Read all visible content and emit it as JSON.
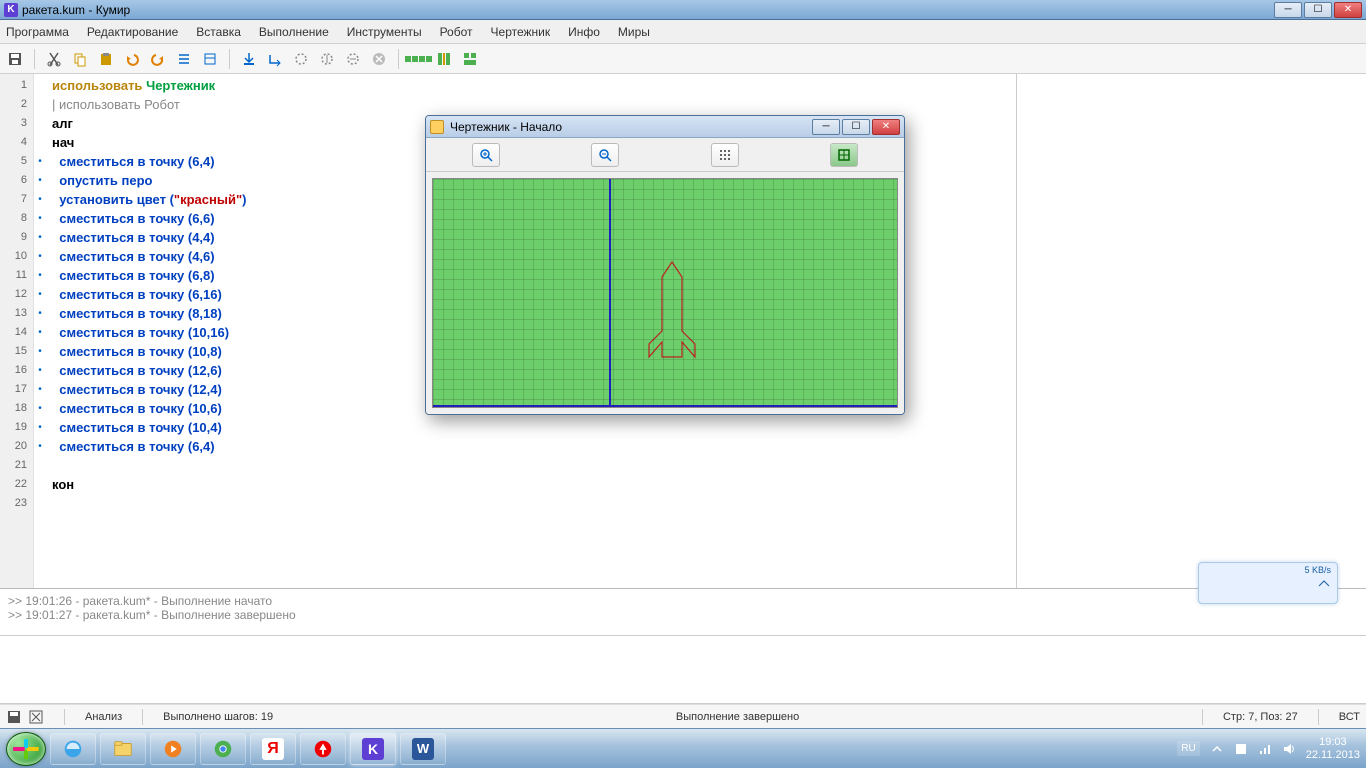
{
  "window": {
    "title": "ракета.kum - Кумир",
    "icon_letter": "K"
  },
  "menu": [
    "Программа",
    "Редактирование",
    "Вставка",
    "Выполнение",
    "Инструменты",
    "Робот",
    "Чертежник",
    "Инфо",
    "Миры"
  ],
  "code": {
    "lines": [
      {
        "type": "use",
        "kw": "использовать",
        "mod": "Чертежник"
      },
      {
        "type": "suggest",
        "text": "использовать Робот"
      },
      {
        "type": "struct",
        "text": "алг"
      },
      {
        "type": "struct",
        "text": "нач"
      },
      {
        "type": "cmd",
        "cmd": "сместиться в точку",
        "args": [
          "6",
          "4"
        ]
      },
      {
        "type": "cmd",
        "cmd": "опустить перо"
      },
      {
        "type": "cmd",
        "cmd": "установить цвет",
        "strargs": [
          "\"красный\""
        ]
      },
      {
        "type": "cmd",
        "cmd": "сместиться в точку",
        "args": [
          "6",
          "6"
        ]
      },
      {
        "type": "cmd",
        "cmd": "сместиться в точку",
        "args": [
          "4",
          "4"
        ]
      },
      {
        "type": "cmd",
        "cmd": "сместиться в точку",
        "args": [
          "4",
          "6"
        ]
      },
      {
        "type": "cmd",
        "cmd": "сместиться в точку",
        "args": [
          "6",
          "8"
        ]
      },
      {
        "type": "cmd",
        "cmd": "сместиться в точку",
        "args": [
          "6",
          "16"
        ]
      },
      {
        "type": "cmd",
        "cmd": "сместиться в точку",
        "args": [
          "8",
          "18"
        ]
      },
      {
        "type": "cmd",
        "cmd": "сместиться в точку",
        "args": [
          "10",
          "16"
        ]
      },
      {
        "type": "cmd",
        "cmd": "сместиться в точку",
        "args": [
          "10",
          "8"
        ]
      },
      {
        "type": "cmd",
        "cmd": "сместиться в точку",
        "args": [
          "12",
          "6"
        ]
      },
      {
        "type": "cmd",
        "cmd": "сместиться в точку",
        "args": [
          "12",
          "4"
        ]
      },
      {
        "type": "cmd",
        "cmd": "сместиться в точку",
        "args": [
          "10",
          "6"
        ]
      },
      {
        "type": "cmd",
        "cmd": "сместиться в точку",
        "args": [
          "10",
          "4"
        ]
      },
      {
        "type": "cmd",
        "cmd": "сместиться в точку",
        "args": [
          "6",
          "4"
        ]
      },
      {
        "type": "blank"
      },
      {
        "type": "struct",
        "text": "кон"
      },
      {
        "type": "blank"
      }
    ]
  },
  "console": [
    ">> 19:01:26 - ракета.kum* - Выполнение начато",
    ">> 19:01:27 - ракета.kum* - Выполнение завершено"
  ],
  "status": {
    "analysis": "Анализ",
    "steps": "Выполнено шагов: 19",
    "runmsg": "Выполнение завершено",
    "pos": "Стр: 7, Поз: 27",
    "mode": "ВСТ"
  },
  "child": {
    "title": "Чертежник - Начало"
  },
  "gadget": {
    "speed": "5 KB/s"
  },
  "taskbar": {
    "lang": "RU",
    "time": "19:03",
    "date": "22.11.2013"
  }
}
